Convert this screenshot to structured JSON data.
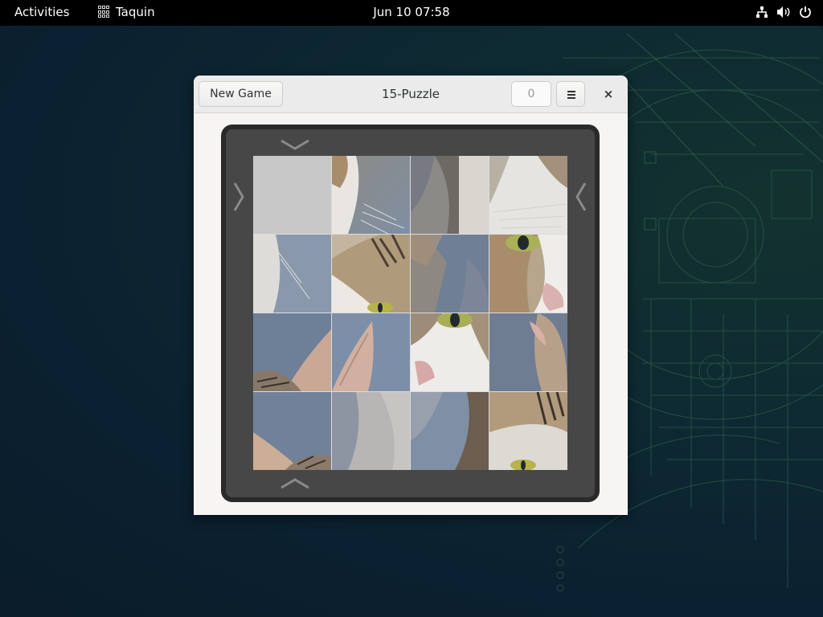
{
  "topbar": {
    "activities": "Activities",
    "app_name": "Taquin",
    "clock": "Jun 10  07:58"
  },
  "window": {
    "title": "15-Puzzle",
    "new_game_label": "New Game",
    "moves_count": "0",
    "close_glyph": "×"
  },
  "board": {
    "rows": 4,
    "cols": 4,
    "empty_tile": {
      "row": 0,
      "col": 0
    },
    "image_subject": "cat",
    "arrows": [
      "chevron-down-icon",
      "chevron-up-icon",
      "chevron-right-icon",
      "chevron-left-icon"
    ]
  },
  "colors": {
    "topbar": "#000000",
    "window_bg": "#f6f5f4",
    "frame_border": "#2a2a2a",
    "frame_fill": "#474747",
    "empty_tile": "#c8c8c8"
  }
}
